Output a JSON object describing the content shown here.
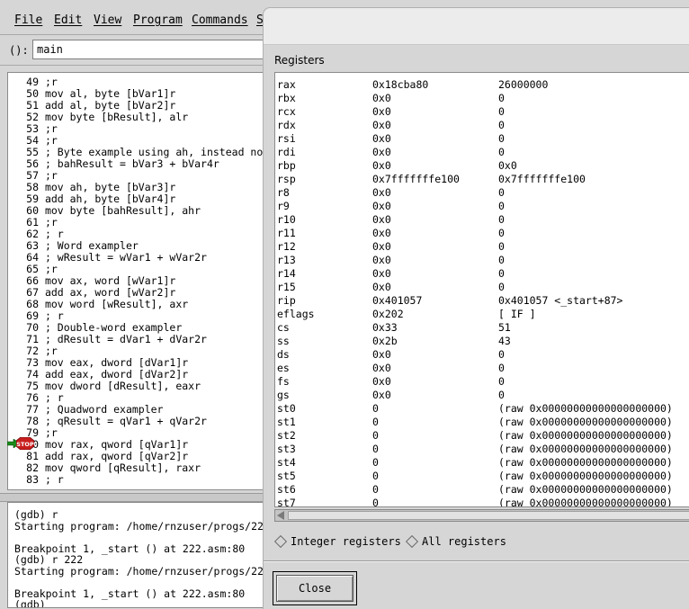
{
  "menu": {
    "items": [
      "File",
      "Edit",
      "View",
      "Program",
      "Commands",
      "S"
    ]
  },
  "argbar": {
    "label": "():",
    "value": "main"
  },
  "source": {
    "lines": [
      {
        "n": "49",
        "t": ";r"
      },
      {
        "n": "50",
        "t": "mov al, byte [bVar1]r"
      },
      {
        "n": "51",
        "t": "add al, byte [bVar2]r"
      },
      {
        "n": "52",
        "t": "mov byte [bResult], alr"
      },
      {
        "n": "53",
        "t": ";r"
      },
      {
        "n": "54",
        "t": ";r"
      },
      {
        "n": "55",
        "t": "; Byte example using ah, instead no"
      },
      {
        "n": "56",
        "t": "; bahResult = bVar3 + bVar4r"
      },
      {
        "n": "57",
        "t": ";r"
      },
      {
        "n": "58",
        "t": "mov ah, byte [bVar3]r"
      },
      {
        "n": "59",
        "t": "add ah, byte [bVar4]r"
      },
      {
        "n": "60",
        "t": "mov byte [bahResult], ahr"
      },
      {
        "n": "61",
        "t": ";r"
      },
      {
        "n": "62",
        "t": "; r"
      },
      {
        "n": "63",
        "t": "; Word exampler"
      },
      {
        "n": "64",
        "t": "; wResult = wVar1 + wVar2r"
      },
      {
        "n": "65",
        "t": ";r"
      },
      {
        "n": "66",
        "t": "mov ax, word [wVar1]r"
      },
      {
        "n": "67",
        "t": "add ax, word [wVar2]r"
      },
      {
        "n": "68",
        "t": "mov word [wResult], axr"
      },
      {
        "n": "69",
        "t": "; r"
      },
      {
        "n": "70",
        "t": "; Double-word exampler"
      },
      {
        "n": "71",
        "t": "; dResult = dVar1 + dVar2r"
      },
      {
        "n": "72",
        "t": ";r"
      },
      {
        "n": "73",
        "t": "mov eax, dword [dVar1]r"
      },
      {
        "n": "74",
        "t": "add eax, dword [dVar2]r"
      },
      {
        "n": "75",
        "t": "mov dword [dResult], eaxr"
      },
      {
        "n": "76",
        "t": "; r"
      },
      {
        "n": "77",
        "t": "; Quadword exampler"
      },
      {
        "n": "78",
        "t": "; qResult = qVar1 + qVar2r"
      },
      {
        "n": "79",
        "t": ";r"
      },
      {
        "n": "80",
        "t": "mov rax, qword [qVar1]r"
      },
      {
        "n": "81",
        "t": "add rax, qword [qVar2]r"
      },
      {
        "n": "82",
        "t": "mov qword [qResult], raxr"
      },
      {
        "n": "83",
        "t": "; r"
      }
    ],
    "breakpoint_label": "STOP"
  },
  "console": {
    "lines": [
      "(gdb) r",
      "Starting program: /home/rnzuser/progs/22",
      "",
      "Breakpoint 1, _start () at 222.asm:80",
      "(gdb) r 222",
      "Starting program: /home/rnzuser/progs/22",
      "",
      "Breakpoint 1, _start () at 222.asm:80",
      "(gdb)"
    ]
  },
  "registers": {
    "title": "Registers",
    "rows": [
      {
        "name": "rax",
        "hex": "0x18cba80",
        "natural": "26000000"
      },
      {
        "name": "rbx",
        "hex": "0x0",
        "natural": "0"
      },
      {
        "name": "rcx",
        "hex": "0x0",
        "natural": "0"
      },
      {
        "name": "rdx",
        "hex": "0x0",
        "natural": "0"
      },
      {
        "name": "rsi",
        "hex": "0x0",
        "natural": "0"
      },
      {
        "name": "rdi",
        "hex": "0x0",
        "natural": "0"
      },
      {
        "name": "rbp",
        "hex": "0x0",
        "natural": "0x0"
      },
      {
        "name": "rsp",
        "hex": "0x7fffffffe100",
        "natural": "0x7fffffffe100"
      },
      {
        "name": "r8",
        "hex": "0x0",
        "natural": "0"
      },
      {
        "name": "r9",
        "hex": "0x0",
        "natural": "0"
      },
      {
        "name": "r10",
        "hex": "0x0",
        "natural": "0"
      },
      {
        "name": "r11",
        "hex": "0x0",
        "natural": "0"
      },
      {
        "name": "r12",
        "hex": "0x0",
        "natural": "0"
      },
      {
        "name": "r13",
        "hex": "0x0",
        "natural": "0"
      },
      {
        "name": "r14",
        "hex": "0x0",
        "natural": "0"
      },
      {
        "name": "r15",
        "hex": "0x0",
        "natural": "0"
      },
      {
        "name": "rip",
        "hex": "0x401057",
        "natural": "0x401057 <_start+87>"
      },
      {
        "name": "eflags",
        "hex": "0x202",
        "natural": "[ IF ]"
      },
      {
        "name": "cs",
        "hex": "0x33",
        "natural": "51"
      },
      {
        "name": "ss",
        "hex": "0x2b",
        "natural": "43"
      },
      {
        "name": "ds",
        "hex": "0x0",
        "natural": "0"
      },
      {
        "name": "es",
        "hex": "0x0",
        "natural": "0"
      },
      {
        "name": "fs",
        "hex": "0x0",
        "natural": "0"
      },
      {
        "name": "gs",
        "hex": "0x0",
        "natural": "0"
      },
      {
        "name": "st0",
        "hex": "0",
        "natural": "(raw 0x00000000000000000000)"
      },
      {
        "name": "st1",
        "hex": "0",
        "natural": "(raw 0x00000000000000000000)"
      },
      {
        "name": "st2",
        "hex": "0",
        "natural": "(raw 0x00000000000000000000)"
      },
      {
        "name": "st3",
        "hex": "0",
        "natural": "(raw 0x00000000000000000000)"
      },
      {
        "name": "st4",
        "hex": "0",
        "natural": "(raw 0x00000000000000000000)"
      },
      {
        "name": "st5",
        "hex": "0",
        "natural": "(raw 0x00000000000000000000)"
      },
      {
        "name": "st6",
        "hex": "0",
        "natural": "(raw 0x00000000000000000000)"
      },
      {
        "name": "st7",
        "hex": "0",
        "natural": "(raw 0x00000000000000000000)"
      }
    ],
    "radio_integer": "Integer registers",
    "radio_all": "All registers",
    "close_label": "Close"
  }
}
